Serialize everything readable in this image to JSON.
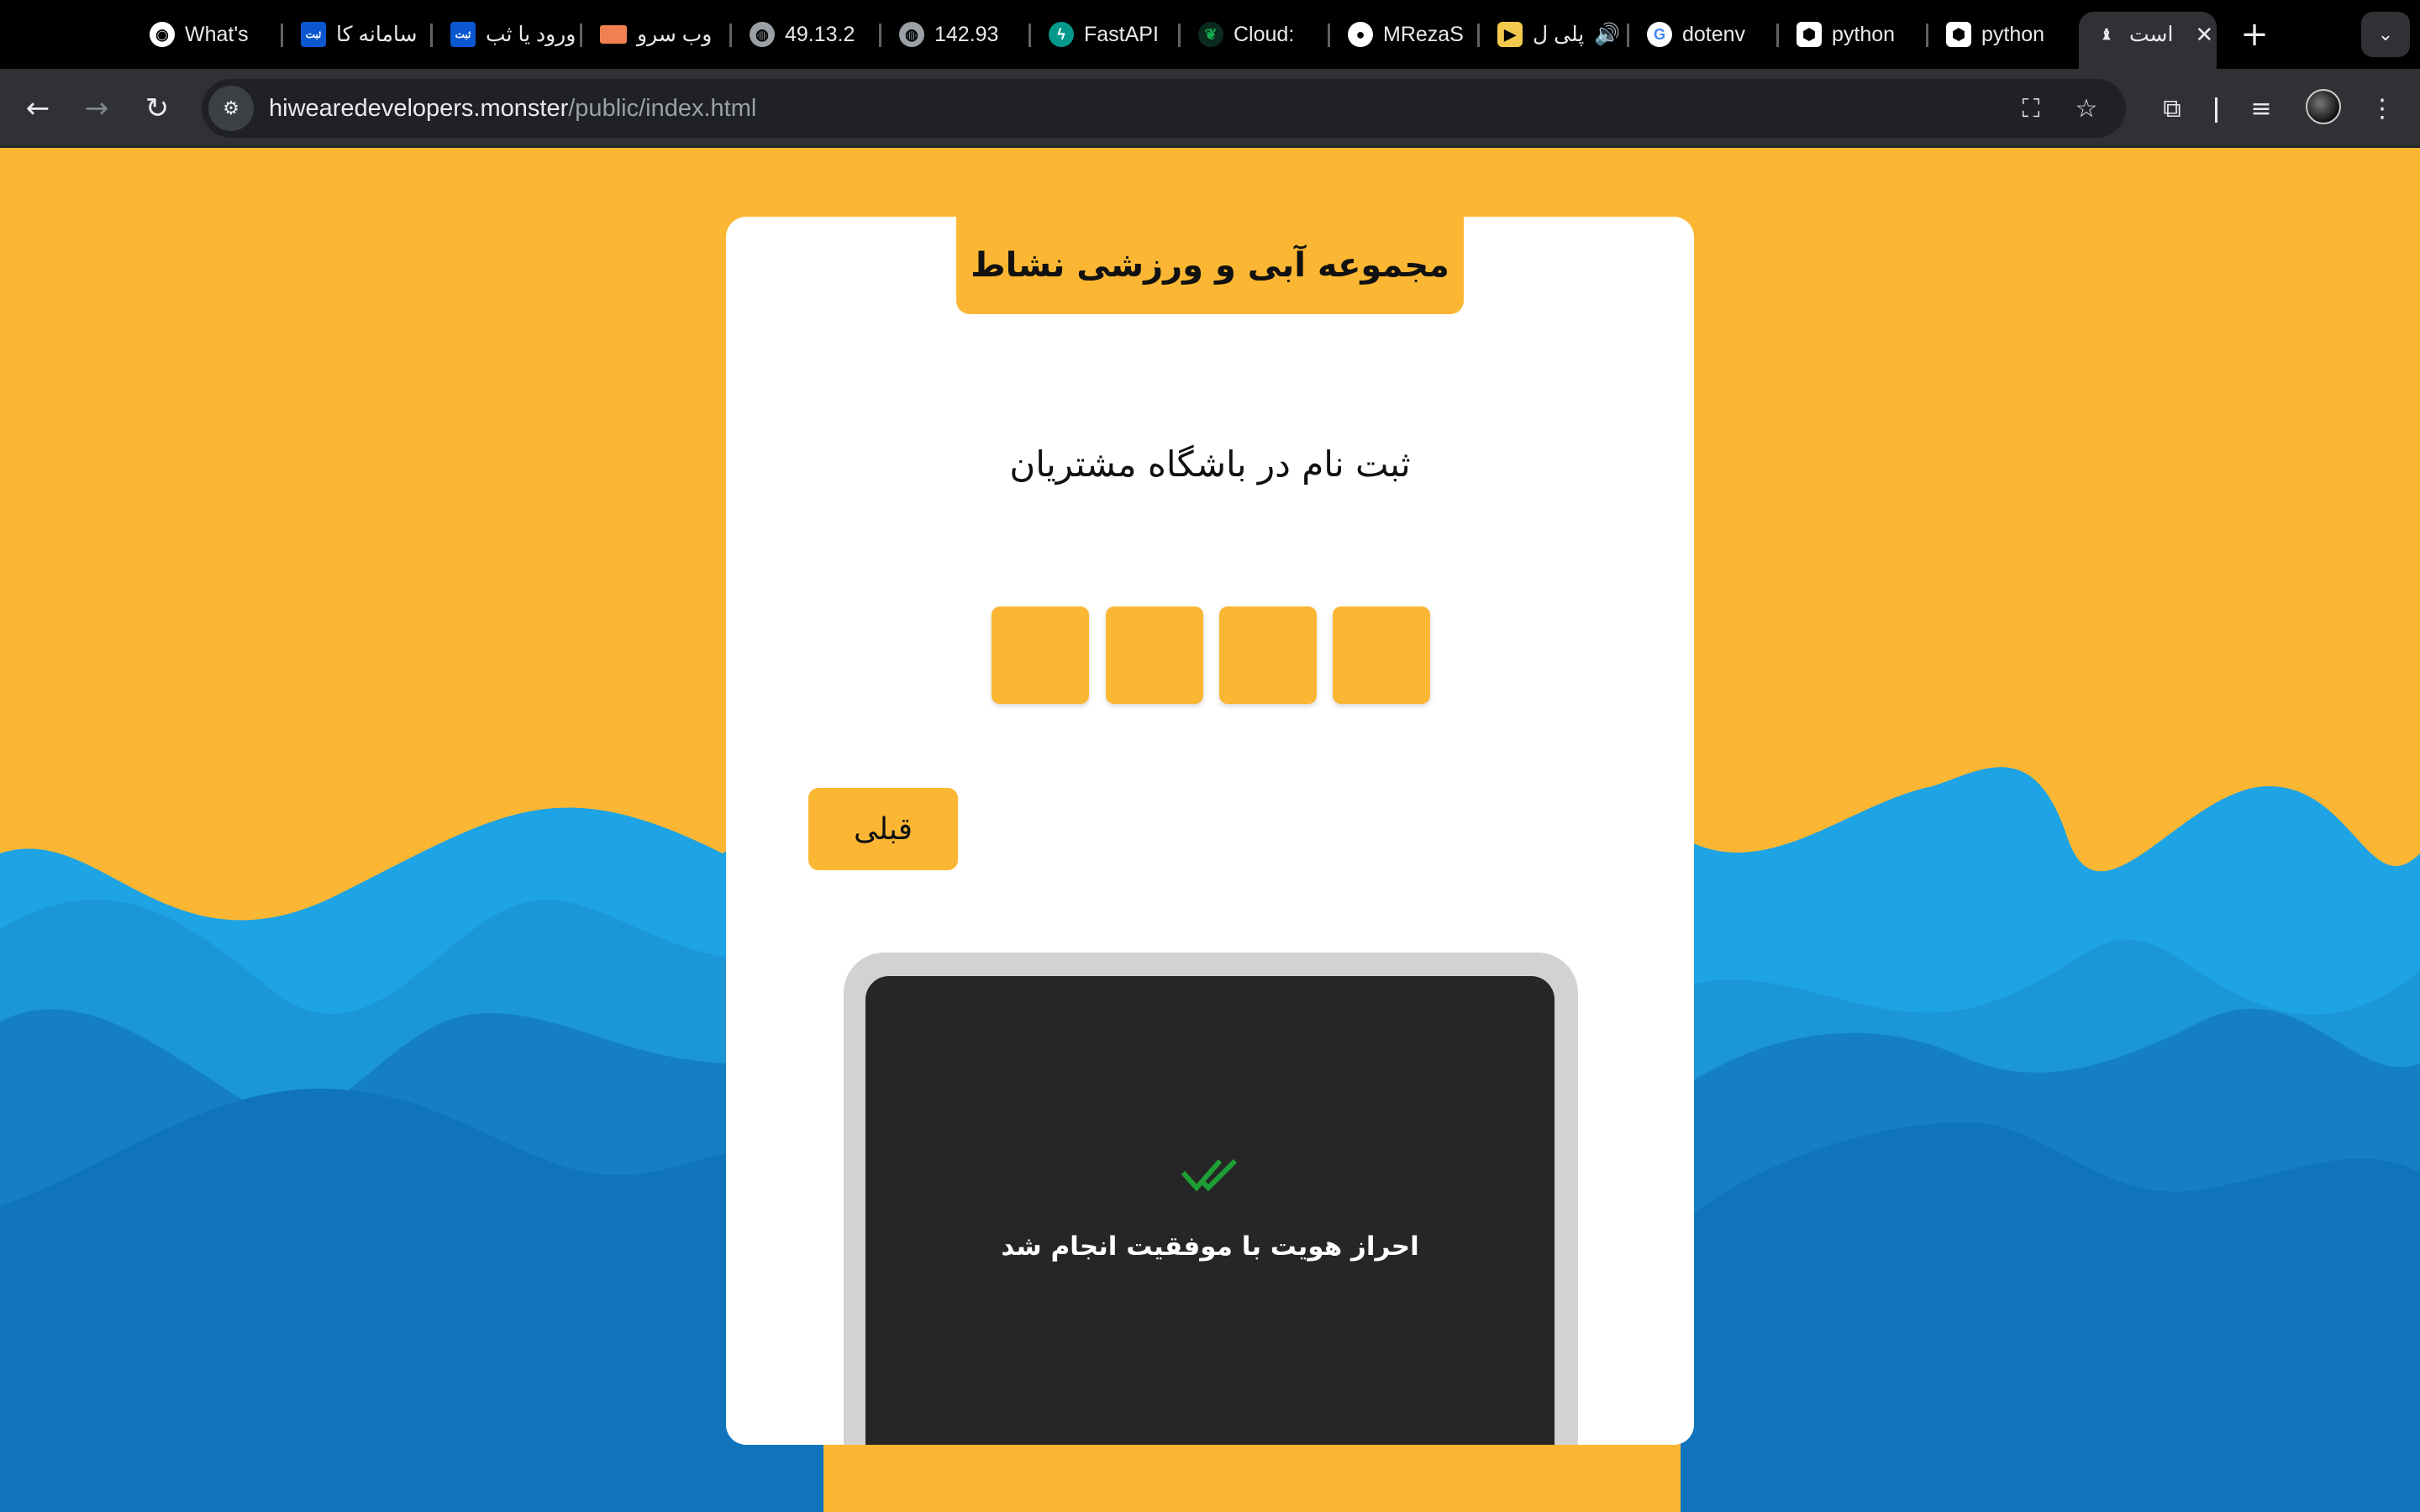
{
  "browser": {
    "tabs": [
      {
        "label": "What's",
        "icon": "chrome-icon"
      },
      {
        "label": "سامانه کا",
        "icon": "site-logo-icon"
      },
      {
        "label": "ورود یا ثب",
        "icon": "site-logo-icon"
      },
      {
        "label": "وب سرو",
        "icon": "server-icon"
      },
      {
        "label": "49.13.2",
        "icon": "globe-icon"
      },
      {
        "label": "142.93",
        "icon": "globe-icon"
      },
      {
        "label": "FastAPI",
        "icon": "fastapi-icon"
      },
      {
        "label": "Cloud:",
        "icon": "mongodb-icon"
      },
      {
        "label": "MRezaS",
        "icon": "github-icon"
      },
      {
        "label": "پلی ل",
        "icon": "player-icon"
      },
      {
        "label": "dotenv",
        "icon": "google-icon"
      },
      {
        "label": "python",
        "icon": "package-icon"
      },
      {
        "label": "python",
        "icon": "package-icon"
      },
      {
        "label": "است",
        "icon": "app-icon",
        "active": true
      }
    ],
    "url_host": "hiwearedevelopers.monster",
    "url_path": "/public/index.html"
  },
  "page": {
    "header_title": "مجموعه آبی و ورزشی نشاط",
    "subtitle": "ثبت نام در باشگاه مشتریان",
    "otp_digits": [
      "",
      "",
      "",
      ""
    ],
    "prev_button": "قبلی",
    "success_message": "احراز هویت با موفقیت انجام شد"
  },
  "colors": {
    "background": "#fbb733",
    "accent": "#fbb733",
    "wave_light": "#1ea3e4",
    "wave_dark": "#0f74bb",
    "phone_screen": "#262626",
    "success_check": "#1e9e34"
  }
}
